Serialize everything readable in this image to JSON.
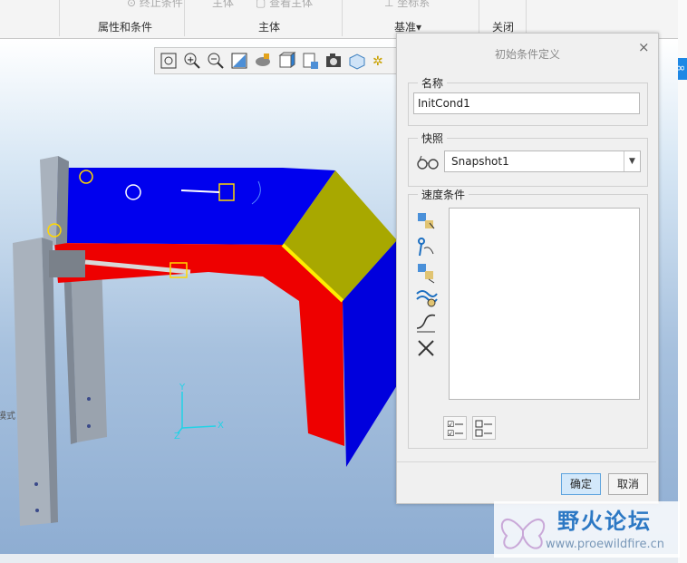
{
  "ribbon": {
    "faded_items": [
      "终止条件",
      "主体",
      "查看主体",
      "坐标系"
    ],
    "groups": [
      "属性和条件",
      "主体",
      "基准",
      "关闭"
    ],
    "datum_arrow": "▾"
  },
  "view_toolbar": {
    "buttons": [
      "zoom-fit-icon",
      "zoom-in-icon",
      "zoom-out-icon",
      "repaint-icon",
      "view-orient-icon",
      "display-style-icon",
      "saved-views-icon",
      "snapshot-icon",
      "model-display-icon",
      "datum-display-icon"
    ]
  },
  "viewport": {
    "axis_y": "Y",
    "axis_x": "X",
    "axis_z": "Z",
    "side_text": "模式"
  },
  "dialog": {
    "title": "初始条件定义",
    "close": "×",
    "name_label": "名称",
    "name_value": "InitCond1",
    "snapshot_label": "快照",
    "snapshot_value": "Snapshot1",
    "snapshot_arrow": "▼",
    "velocity_label": "速度条件",
    "velocity_tools": [
      "point-velocity-icon",
      "connection-velocity-icon",
      "angular-velocity-icon",
      "tangent-slot-velocity-icon",
      "motion-axis-velocity-icon",
      "delete-icon"
    ],
    "list_tools": [
      "select-all-icon",
      "deselect-all-icon"
    ],
    "ok": "确定",
    "cancel": "取消"
  },
  "watermark": {
    "title": "野火论坛",
    "url": "www.proewildfire.cn"
  },
  "colors": {
    "blue_panel": "#0000ee",
    "red_panel": "#ee0000",
    "olive_panel": "#a8a800",
    "frame_gray": "#a9b2bd",
    "ok_highlight": "#d3e8fa"
  }
}
